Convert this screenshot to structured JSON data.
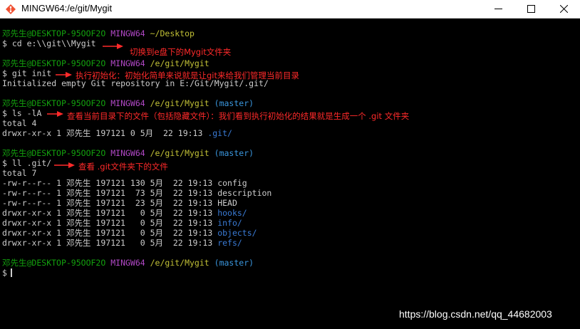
{
  "window": {
    "title": "MINGW64:/e/git/Mygit",
    "icons": {
      "app": "git-bash-icon",
      "minimize": "minimize-icon",
      "maximize": "maximize-icon",
      "close": "close-icon"
    }
  },
  "colors": {
    "user": "#13a10e",
    "shell": "#b148c6",
    "path": "#c1c036",
    "branch": "#3a96dd",
    "dir": "#3a7bd5",
    "text": "#cccccc",
    "note": "#ff2a2a"
  },
  "terminal": {
    "p1": {
      "user": "邓先生@DESKTOP-95OOF2O",
      "shell": "MINGW64",
      "path": "~/Desktop"
    },
    "cmd1": "$ cd e:\\\\git\\\\Mygit",
    "note1": "切换到e盘下的Mygit文件夹",
    "p2": {
      "user": "邓先生@DESKTOP-95OOF2O",
      "shell": "MINGW64",
      "path": "/e/git/Mygit"
    },
    "cmd2": "$ git init",
    "note2": "执行初始化：初始化简单来说就是让git来给我们管理当前目录",
    "out2": "Initialized empty Git repository in E:/Git/Mygit/.git/",
    "p3": {
      "user": "邓先生@DESKTOP-95OOF2O",
      "shell": "MINGW64",
      "path": "/e/git/Mygit",
      "branch": "(master)"
    },
    "cmd3": "$ ls -lA",
    "note3": "查看当前目录下的文件（包括隐藏文件）：我们看到执行初始化的结果就是生成一个 .git 文件夹",
    "out3a": "total 4",
    "out3b": {
      "prefix": "drwxr-xr-x 1 邓先生 197121 0 5月  22 19:13 ",
      "name": ".git/"
    },
    "p4": {
      "user": "邓先生@DESKTOP-95OOF2O",
      "shell": "MINGW64",
      "path": "/e/git/Mygit",
      "branch": "(master)"
    },
    "cmd4": "$ ll .git/",
    "note4": "查看 .git文件夹下的文件",
    "total4": "total 7",
    "files": [
      {
        "prefix": "-rw-r--r-- 1 邓先生 197121 130 5月  22 19:13 ",
        "name": "config",
        "dir": false
      },
      {
        "prefix": "-rw-r--r-- 1 邓先生 197121  73 5月  22 19:13 ",
        "name": "description",
        "dir": false
      },
      {
        "prefix": "-rw-r--r-- 1 邓先生 197121  23 5月  22 19:13 ",
        "name": "HEAD",
        "dir": false
      },
      {
        "prefix": "drwxr-xr-x 1 邓先生 197121   0 5月  22 19:13 ",
        "name": "hooks/",
        "dir": true
      },
      {
        "prefix": "drwxr-xr-x 1 邓先生 197121   0 5月  22 19:13 ",
        "name": "info/",
        "dir": true
      },
      {
        "prefix": "drwxr-xr-x 1 邓先生 197121   0 5月  22 19:13 ",
        "name": "objects/",
        "dir": true
      },
      {
        "prefix": "drwxr-xr-x 1 邓先生 197121   0 5月  22 19:13 ",
        "name": "refs/",
        "dir": true
      }
    ],
    "p5": {
      "user": "邓先生@DESKTOP-95OOF2O",
      "shell": "MINGW64",
      "path": "/e/git/Mygit",
      "branch": "(master)"
    },
    "cmd5": "$ "
  },
  "watermark": "https://blog.csdn.net/qq_44682003"
}
